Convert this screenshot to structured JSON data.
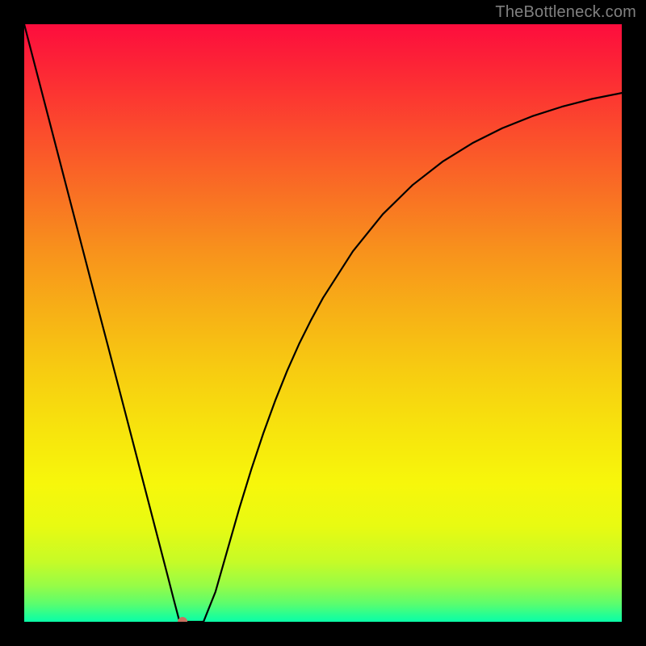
{
  "watermark": "TheBottleneck.com",
  "chart_data": {
    "type": "line",
    "title": "",
    "xlabel": "",
    "ylabel": "",
    "xlim": [
      0,
      100
    ],
    "ylim": [
      0,
      100
    ],
    "grid": false,
    "background": "red-yellow-green vertical gradient",
    "series": [
      {
        "name": "bottleneck-curve",
        "x": [
          0,
          2,
          4,
          6,
          8,
          10,
          12,
          14,
          16,
          18,
          20,
          22,
          24,
          25,
          26,
          27,
          28,
          29,
          30,
          32,
          34,
          36,
          38,
          40,
          42,
          44,
          46,
          48,
          50,
          55,
          60,
          65,
          70,
          75,
          80,
          85,
          90,
          95,
          100
        ],
        "values": [
          100,
          92.3,
          84.6,
          76.9,
          69.2,
          61.5,
          53.8,
          46.2,
          38.5,
          30.8,
          23.1,
          15.4,
          7.7,
          3.8,
          0,
          0,
          0,
          0,
          0,
          5,
          12,
          19,
          25.5,
          31.5,
          37,
          42,
          46.5,
          50.5,
          54.2,
          62,
          68.2,
          73.1,
          77,
          80.1,
          82.6,
          84.6,
          86.2,
          87.5,
          88.5
        ]
      }
    ],
    "marker": {
      "x": 26.5,
      "y": 0,
      "color": "#c97060"
    }
  },
  "gradient": {
    "stops": [
      {
        "offset": 0.0,
        "color": "#fd0d3d"
      },
      {
        "offset": 0.08,
        "color": "#fc2835"
      },
      {
        "offset": 0.18,
        "color": "#fb4c2c"
      },
      {
        "offset": 0.28,
        "color": "#f96f24"
      },
      {
        "offset": 0.38,
        "color": "#f8921c"
      },
      {
        "offset": 0.48,
        "color": "#f7b016"
      },
      {
        "offset": 0.58,
        "color": "#f7cc11"
      },
      {
        "offset": 0.68,
        "color": "#f7e40d"
      },
      {
        "offset": 0.77,
        "color": "#f7f70b"
      },
      {
        "offset": 0.84,
        "color": "#e8fa12"
      },
      {
        "offset": 0.9,
        "color": "#c6fb27"
      },
      {
        "offset": 0.94,
        "color": "#96fc47"
      },
      {
        "offset": 0.97,
        "color": "#5bfd6e"
      },
      {
        "offset": 0.99,
        "color": "#22fe96"
      },
      {
        "offset": 1.0,
        "color": "#0afea8"
      }
    ]
  }
}
